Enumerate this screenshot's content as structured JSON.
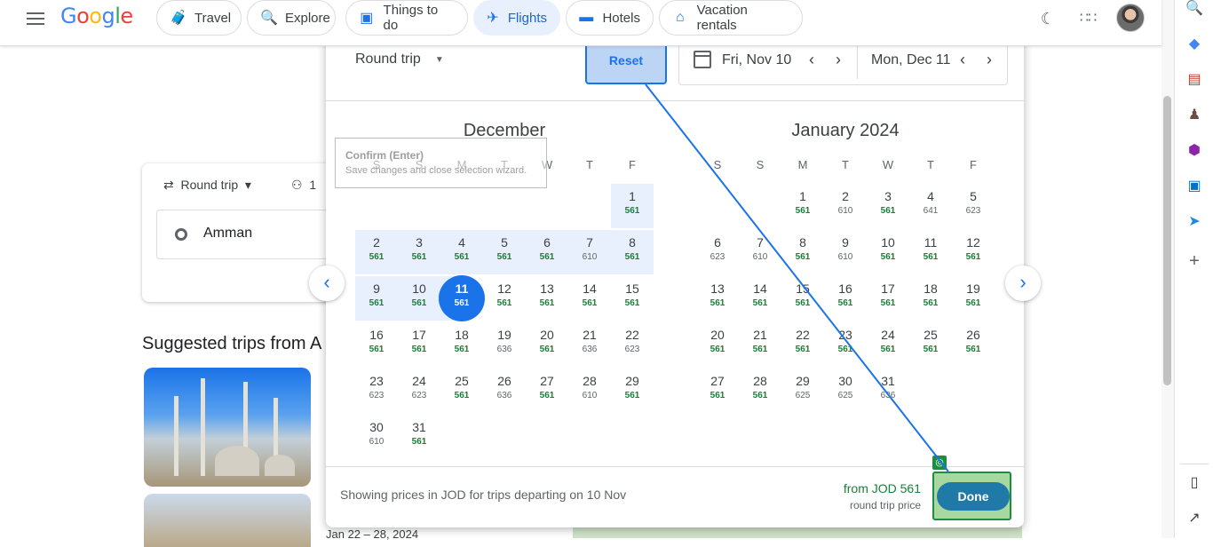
{
  "topbar": {
    "logo": "Google",
    "tabs": [
      {
        "label": "Travel",
        "icon": "travel-icon"
      },
      {
        "label": "Explore",
        "icon": "explore-icon"
      },
      {
        "label": "Things to do",
        "icon": "camera-icon"
      },
      {
        "label": "Flights",
        "icon": "plane-icon",
        "active": true
      },
      {
        "label": "Hotels",
        "icon": "bed-icon"
      },
      {
        "label": "Vacation rentals",
        "icon": "house-icon"
      }
    ]
  },
  "background_page": {
    "trip_type": "Round trip",
    "passengers": "1",
    "origin": "Amman",
    "suggested_heading": "Suggested trips from A",
    "trip_dates": "Jan 22 – 28, 2024"
  },
  "dialog": {
    "trip_type": "Round trip",
    "reset_label": "Reset",
    "departure": "Fri, Nov 10",
    "return": "Mon, Dec 11",
    "tooltip_title": "Confirm (Enter)",
    "tooltip_text": "Save changes and close selection wizard.",
    "weekdays": [
      "S",
      "S",
      "M",
      "T",
      "W",
      "T",
      "F"
    ],
    "months": [
      {
        "title": "December",
        "rows": [
          [
            null,
            null,
            null,
            null,
            null,
            null,
            {
              "d": "1",
              "p": "561"
            }
          ],
          [
            {
              "d": "2",
              "p": "561"
            },
            {
              "d": "3",
              "p": "561"
            },
            {
              "d": "4",
              "p": "561"
            },
            {
              "d": "5",
              "p": "561"
            },
            {
              "d": "6",
              "p": "561"
            },
            {
              "d": "7",
              "p": "610"
            },
            {
              "d": "8",
              "p": "561"
            }
          ],
          [
            {
              "d": "9",
              "p": "561"
            },
            {
              "d": "10",
              "p": "561"
            },
            {
              "d": "11",
              "p": "561"
            },
            {
              "d": "12",
              "p": "561"
            },
            {
              "d": "13",
              "p": "561"
            },
            {
              "d": "14",
              "p": "561"
            },
            {
              "d": "15",
              "p": "561"
            }
          ],
          [
            {
              "d": "16",
              "p": "561"
            },
            {
              "d": "17",
              "p": "561"
            },
            {
              "d": "18",
              "p": "561"
            },
            {
              "d": "19",
              "p": "636"
            },
            {
              "d": "20",
              "p": "561"
            },
            {
              "d": "21",
              "p": "636"
            },
            {
              "d": "22",
              "p": "623"
            }
          ],
          [
            {
              "d": "23",
              "p": "623"
            },
            {
              "d": "24",
              "p": "623"
            },
            {
              "d": "25",
              "p": "561"
            },
            {
              "d": "26",
              "p": "636"
            },
            {
              "d": "27",
              "p": "561"
            },
            {
              "d": "28",
              "p": "610"
            },
            {
              "d": "29",
              "p": "561"
            }
          ],
          [
            {
              "d": "30",
              "p": "610"
            },
            {
              "d": "31",
              "p": "561"
            },
            null,
            null,
            null,
            null,
            null
          ]
        ]
      },
      {
        "title": "January 2024",
        "rows": [
          [
            null,
            null,
            {
              "d": "1",
              "p": "561"
            },
            {
              "d": "2",
              "p": "610"
            },
            {
              "d": "3",
              "p": "561"
            },
            {
              "d": "4",
              "p": "641"
            },
            {
              "d": "5",
              "p": "623"
            }
          ],
          [
            {
              "d": "6",
              "p": "623"
            },
            {
              "d": "7",
              "p": "610"
            },
            {
              "d": "8",
              "p": "561"
            },
            {
              "d": "9",
              "p": "610"
            },
            {
              "d": "10",
              "p": "561"
            },
            {
              "d": "11",
              "p": "561"
            },
            {
              "d": "12",
              "p": "561"
            }
          ],
          [
            {
              "d": "13",
              "p": "561"
            },
            {
              "d": "14",
              "p": "561"
            },
            {
              "d": "15",
              "p": "561"
            },
            {
              "d": "16",
              "p": "561"
            },
            {
              "d": "17",
              "p": "561"
            },
            {
              "d": "18",
              "p": "561"
            },
            {
              "d": "19",
              "p": "561"
            }
          ],
          [
            {
              "d": "20",
              "p": "561"
            },
            {
              "d": "21",
              "p": "561"
            },
            {
              "d": "22",
              "p": "561"
            },
            {
              "d": "23",
              "p": "561"
            },
            {
              "d": "24",
              "p": "561"
            },
            {
              "d": "25",
              "p": "561"
            },
            {
              "d": "26",
              "p": "561"
            }
          ],
          [
            {
              "d": "27",
              "p": "561"
            },
            {
              "d": "28",
              "p": "561"
            },
            {
              "d": "29",
              "p": "625"
            },
            {
              "d": "30",
              "p": "625"
            },
            {
              "d": "31",
              "p": "636"
            },
            null,
            null
          ]
        ]
      }
    ],
    "selected_return": "11",
    "cheap_price": "561",
    "footer_note": "Showing prices in JOD for trips departing on 10 Nov",
    "from_price": "from JOD 561",
    "price_caption": "round trip price",
    "done_label": "Done"
  },
  "colors": {
    "accent": "#1a73e8",
    "cheap": "#188038",
    "range_band": "#e8f0fe"
  }
}
